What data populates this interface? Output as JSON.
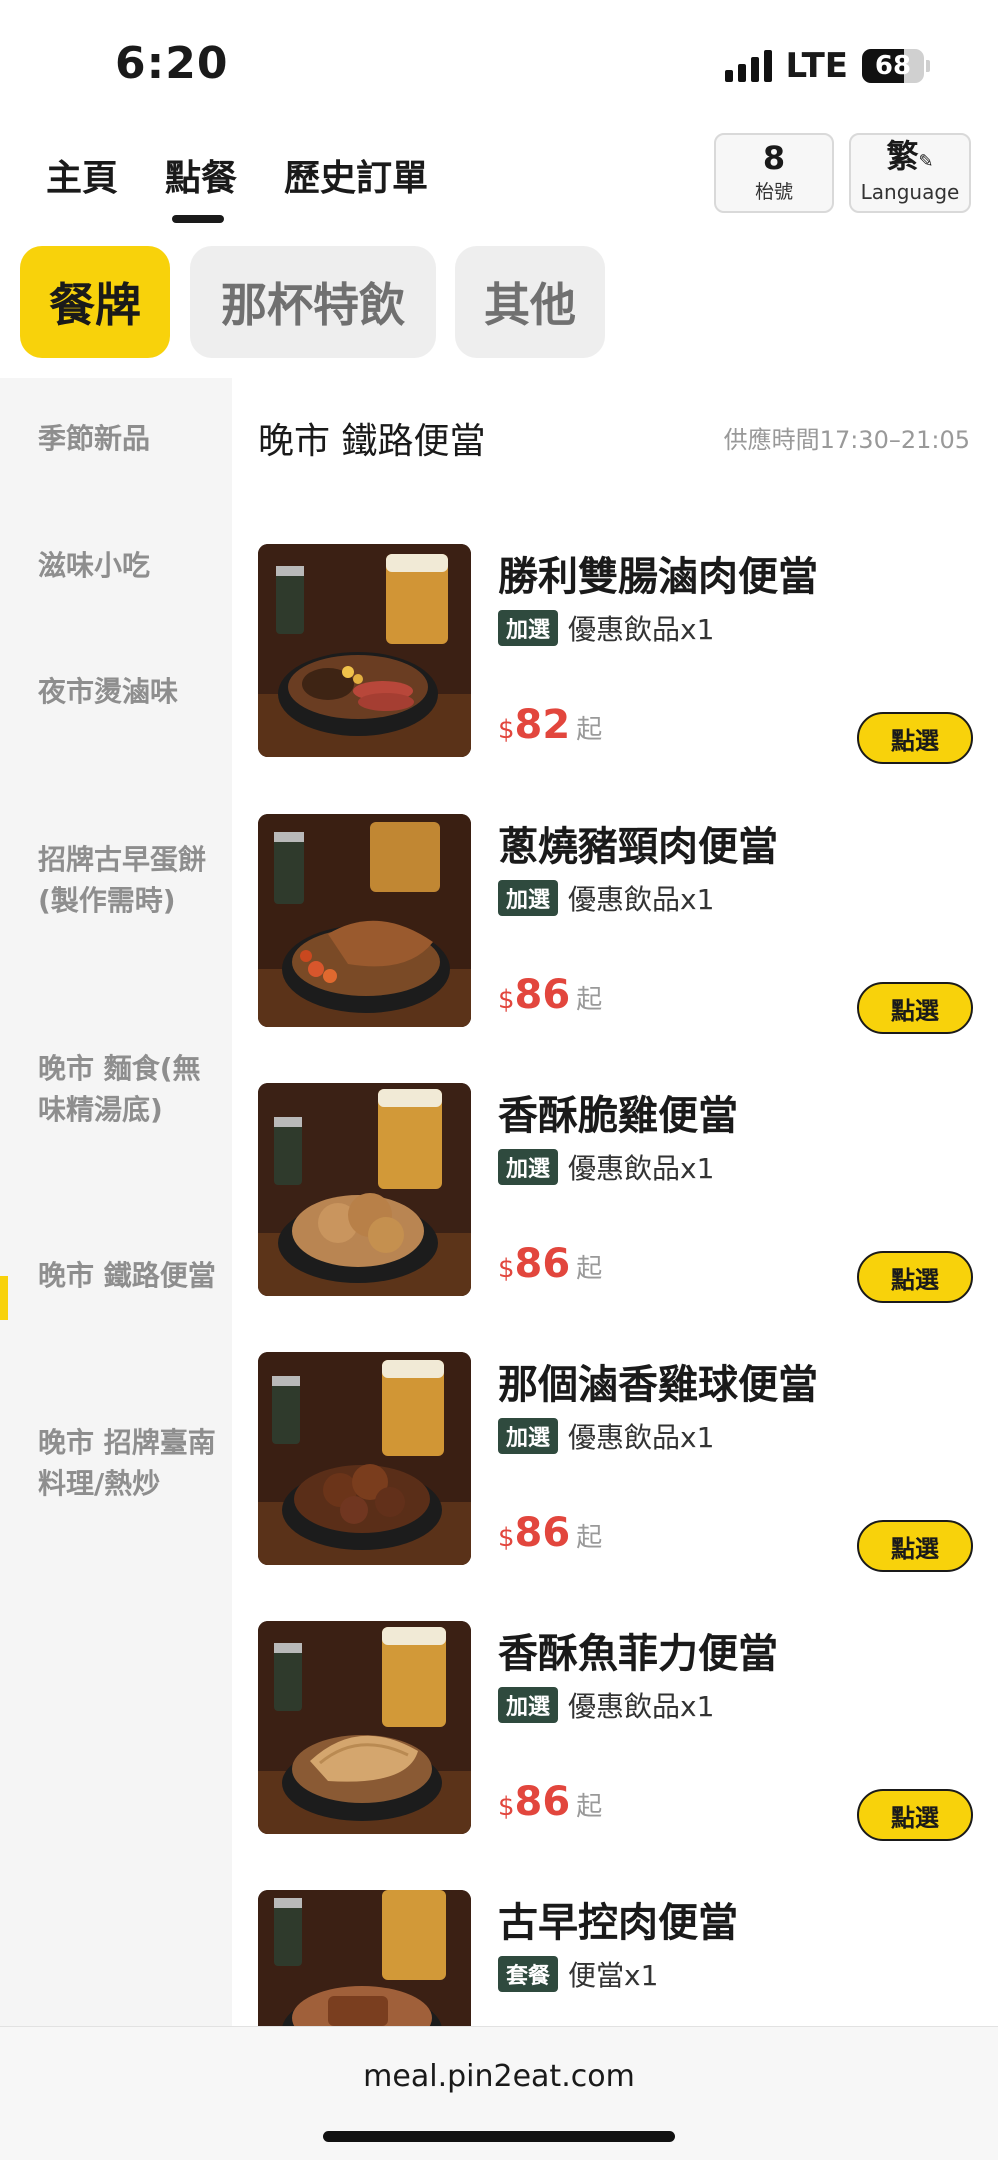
{
  "status": {
    "time": "6:20",
    "network": "LTE",
    "battery": "68",
    "battery_level": 0.68
  },
  "nav": {
    "tabs": [
      {
        "label": "主頁"
      },
      {
        "label": "點餐"
      },
      {
        "label": "歷史訂單"
      }
    ],
    "active_tab": "點餐",
    "table_number": "8",
    "table_label": "枱號",
    "language_char": "繁",
    "language_label": "Language"
  },
  "categories": [
    {
      "label": "餐牌",
      "active": true
    },
    {
      "label": "那杯特飲",
      "active": false
    },
    {
      "label": "其他",
      "active": false
    }
  ],
  "sidebar": {
    "items": [
      {
        "label": "季節新品"
      },
      {
        "label": "滋味小吃"
      },
      {
        "label": "夜市燙滷味"
      },
      {
        "label": "招牌古早蛋餅(製作需時)"
      },
      {
        "label": "晚市 麵食(無味精湯底)"
      },
      {
        "label": "晚市 鐵路便當"
      },
      {
        "label": "晚市 招牌臺南料理/熱炒"
      }
    ],
    "active_index": 5
  },
  "section": {
    "title": "晚市 鐵路便當",
    "hours": "供應時間17:30–21:05"
  },
  "items": [
    {
      "name": "勝利雙腸滷肉便當",
      "badge": "加選",
      "badge_text": "優惠飲品x1",
      "currency": "$",
      "price": "82",
      "price_suffix": "起",
      "button": "點選"
    },
    {
      "name": "蔥燒豬頸肉便當",
      "badge": "加選",
      "badge_text": "優惠飲品x1",
      "currency": "$",
      "price": "86",
      "price_suffix": "起",
      "button": "點選"
    },
    {
      "name": "香酥脆雞便當",
      "badge": "加選",
      "badge_text": "優惠飲品x1",
      "currency": "$",
      "price": "86",
      "price_suffix": "起",
      "button": "點選"
    },
    {
      "name": "那個滷香雞球便當",
      "badge": "加選",
      "badge_text": "優惠飲品x1",
      "currency": "$",
      "price": "86",
      "price_suffix": "起",
      "button": "點選"
    },
    {
      "name": "香酥魚菲力便當",
      "badge": "加選",
      "badge_text": "優惠飲品x1",
      "currency": "$",
      "price": "86",
      "price_suffix": "起",
      "button": "點選"
    },
    {
      "name": "古早控肉便當",
      "badge": "套餐",
      "badge_text": "便當x1"
    }
  ],
  "url_bar": {
    "url": "meal.pin2eat.com"
  },
  "colors": {
    "accent": "#f8d20b",
    "price": "#e2463d",
    "badge": "#2f4a3e"
  }
}
